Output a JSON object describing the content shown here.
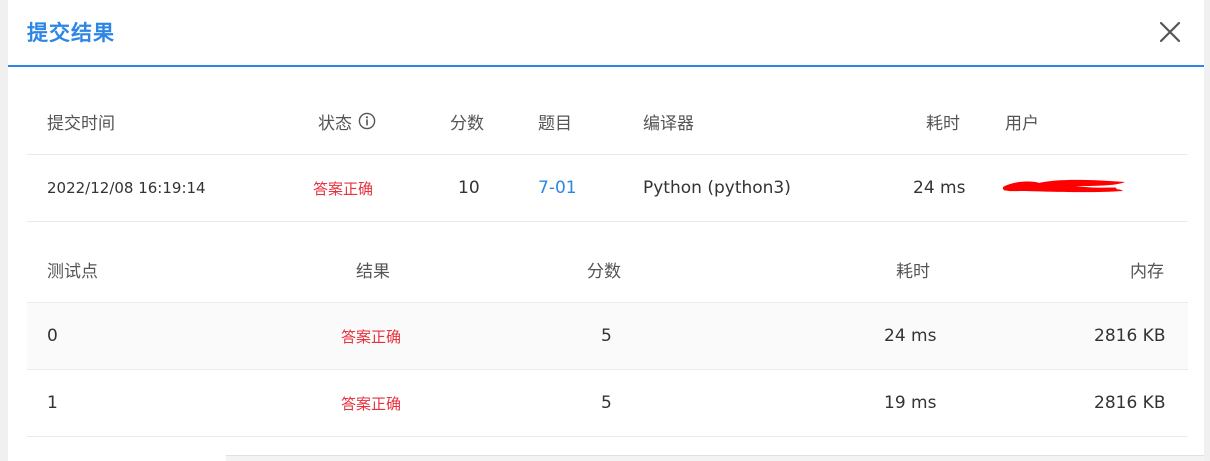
{
  "modal": {
    "title": "提交结果"
  },
  "submission": {
    "columns": {
      "time": "提交时间",
      "status": "状态",
      "score": "分数",
      "problem": "题目",
      "compiler": "编译器",
      "elapsed": "耗时",
      "user": "用户"
    },
    "row": {
      "time": "2022/12/08 16:19:14",
      "status": "答案正确",
      "score": "10",
      "problem": "7-01",
      "compiler": "Python (python3)",
      "elapsed": "24 ms",
      "user": ""
    }
  },
  "testcases": {
    "columns": {
      "case": "测试点",
      "result": "结果",
      "score": "分数",
      "elapsed": "耗时",
      "memory": "内存"
    },
    "rows": [
      {
        "case": "0",
        "result": "答案正确",
        "score": "5",
        "elapsed": "24 ms",
        "memory": "2816 KB"
      },
      {
        "case": "1",
        "result": "答案正确",
        "score": "5",
        "elapsed": "19 ms",
        "memory": "2816 KB"
      }
    ]
  },
  "colors": {
    "accent": "#2d86e6",
    "success_text": "#e5323e",
    "redaction": "#ff0000"
  },
  "icons": {
    "close": "close-icon",
    "status_info": "info-circle-icon"
  }
}
